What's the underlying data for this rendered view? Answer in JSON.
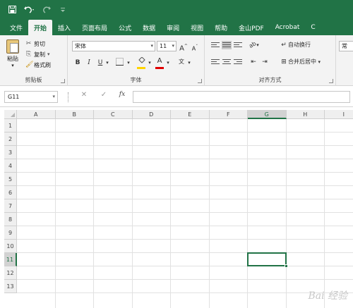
{
  "titlebar": {
    "save_icon": "save-icon",
    "undo_icon": "undo-icon",
    "redo_icon": "redo-icon",
    "customize_icon": "customize-qat-icon"
  },
  "tabs": [
    {
      "label": "文件"
    },
    {
      "label": "开始",
      "active": true
    },
    {
      "label": "插入"
    },
    {
      "label": "页面布局"
    },
    {
      "label": "公式"
    },
    {
      "label": "数据"
    },
    {
      "label": "审阅"
    },
    {
      "label": "视图"
    },
    {
      "label": "帮助"
    },
    {
      "label": "金山PDF"
    },
    {
      "label": "Acrobat"
    },
    {
      "label": "C"
    }
  ],
  "ribbon": {
    "clipboard": {
      "paste": "粘贴",
      "cut": "剪切",
      "copy": "复制",
      "format_painter": "格式刷",
      "group_label": "剪贴板"
    },
    "font": {
      "font_name": "宋体",
      "font_size": "11",
      "grow": "A",
      "shrink": "A",
      "bold": "B",
      "italic": "I",
      "underline": "U",
      "phonetic": "文",
      "group_label": "字体",
      "fill_color": "#ffd400",
      "font_color": "#e00000"
    },
    "alignment": {
      "wrap_text": "自动换行",
      "merge_center": "合并后居中",
      "group_label": "对齐方式",
      "orientation": "ab"
    },
    "number": {
      "label": "常"
    }
  },
  "formula_bar": {
    "name_box": "G11",
    "cancel": "✕",
    "enter": "✓",
    "fx": "fx",
    "formula": ""
  },
  "sheet": {
    "columns": [
      "A",
      "B",
      "C",
      "D",
      "E",
      "F",
      "G",
      "H",
      "I"
    ],
    "rows": [
      "1",
      "2",
      "3",
      "4",
      "5",
      "6",
      "7",
      "8",
      "9",
      "10",
      "11",
      "12",
      "13"
    ],
    "selected_column": "G",
    "selected_row": "11",
    "accent": "#217346"
  },
  "watermark": "Bai 经验"
}
